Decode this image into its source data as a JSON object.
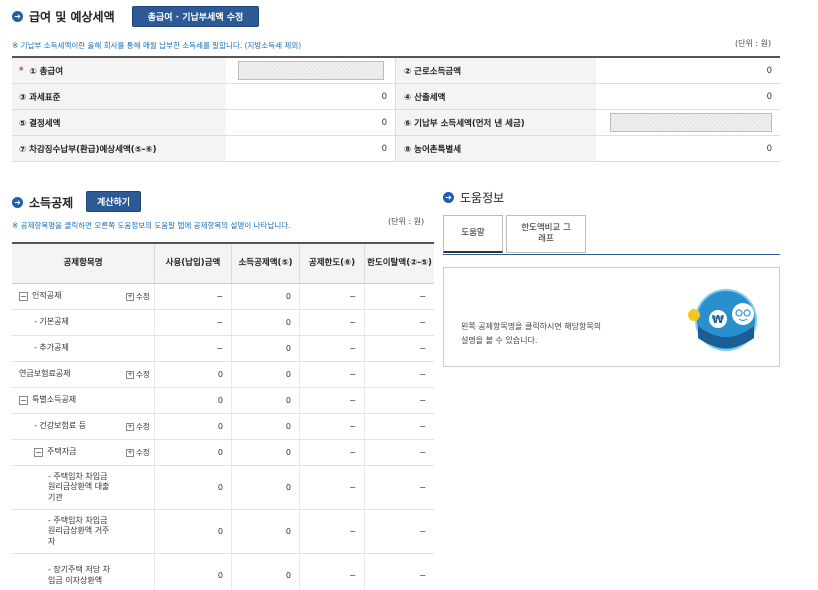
{
  "salary_section": {
    "title": "급여 및 예상세액",
    "edit_button": "총급여 · 기납부세액 수정",
    "note": "※ 기납부 소득세액이란 올해 회사를 통해 매월 납부한 소득세를 말합니다. (지방소득세 제외)",
    "unit": "(단위 : 원)",
    "rows": [
      {
        "left_label": "① 총급여",
        "left_value": "",
        "right_label": "② 근로소득금액",
        "right_value": "0"
      },
      {
        "left_label": "③ 과세표준",
        "left_value": "0",
        "right_label": "④ 산출세액",
        "right_value": "0"
      },
      {
        "left_label": "⑤ 결정세액",
        "left_value": "0",
        "right_label": "⑥ 기납부 소득세액(먼저 낸 세금)",
        "right_value": ""
      },
      {
        "left_label": "⑦ 차감징수납부(환급)예상세액(⑤-⑥)",
        "left_value": "0",
        "right_label": "⑧ 농어촌특별세",
        "right_value": "0"
      }
    ]
  },
  "deduction_section": {
    "title": "소득공제",
    "calc_button": "계산하기",
    "note": "※ 공제항목명을 클릭하면 오른쪽 도움정보의 도움말 탭에 공제항목의 설명이 나타납니다.",
    "unit": "(단위 : 원)",
    "headers": [
      "공제항목명",
      "사용(납입)금액",
      "소득공제액(⑤)",
      "공제한도(⑥)",
      "한도이탈액(②-⑤)"
    ],
    "edit_label": "수정",
    "rows": [
      {
        "name": "인적공제",
        "toggle": "−",
        "edit": true,
        "used": "−",
        "deduction": "0",
        "limit": "−",
        "excess": "−"
      },
      {
        "name": "- 기본공제",
        "toggle": "",
        "edit": false,
        "used": "−",
        "deduction": "0",
        "limit": "−",
        "excess": "−"
      },
      {
        "name": "- 추가공제",
        "toggle": "",
        "edit": false,
        "used": "−",
        "deduction": "0",
        "limit": "−",
        "excess": "−"
      },
      {
        "name": "연금보험료공제",
        "toggle": "",
        "edit": true,
        "used": "0",
        "deduction": "0",
        "limit": "−",
        "excess": "−"
      },
      {
        "name": "특별소득공제",
        "toggle": "−",
        "edit": false,
        "used": "0",
        "deduction": "0",
        "limit": "−",
        "excess": "−"
      },
      {
        "name": "- 건강보험료 등",
        "toggle": "",
        "edit": true,
        "used": "0",
        "deduction": "0",
        "limit": "−",
        "excess": "−"
      },
      {
        "name": "주택자금",
        "toggle": "−",
        "edit": true,
        "used": "0",
        "deduction": "0",
        "limit": "−",
        "excess": "−"
      },
      {
        "name": "- 주택임차 차입금 원리금상환액 대출기관",
        "toggle": "",
        "edit": false,
        "used": "0",
        "deduction": "0",
        "limit": "−",
        "excess": "−"
      },
      {
        "name": "- 주택임차 차입금 원리금상환액 거주자",
        "toggle": "",
        "edit": false,
        "used": "0",
        "deduction": "0",
        "limit": "−",
        "excess": "−"
      },
      {
        "name": "- 장기주택 저당 차입금 이자상환액",
        "toggle": "",
        "edit": false,
        "used": "0",
        "deduction": "0",
        "limit": "−",
        "excess": "−"
      }
    ]
  },
  "help_section": {
    "title": "도움정보",
    "tabs": [
      "도움말",
      "한도액비교 그래프"
    ],
    "text_line1": "왼쪽 공제항목명을 클릭하시면 해당항목의",
    "text_line2": "설명을 볼 수 있습니다."
  },
  "colors": {
    "accent": "#2b5a96",
    "note": "#1a6fb8",
    "required": "#d22222"
  }
}
